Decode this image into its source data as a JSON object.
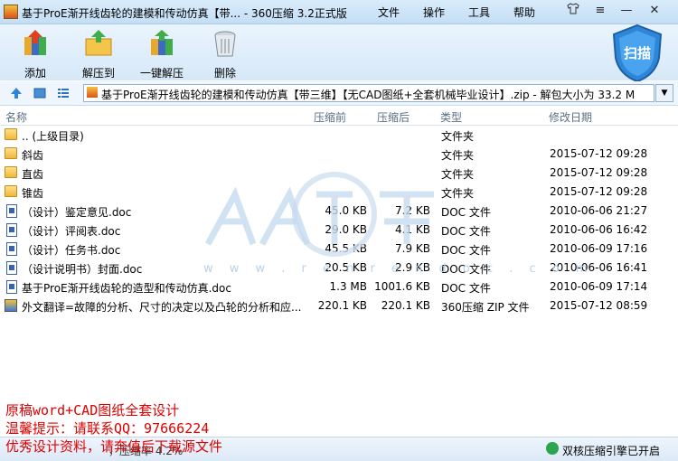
{
  "window": {
    "title": "基于ProE渐开线齿轮的建模和传动仿真【带... - 360压缩 3.2正式版",
    "menu": [
      "文件",
      "操作",
      "工具",
      "帮助"
    ],
    "controls": [
      "shirt-icon",
      "menu-lines-icon",
      "minimize-icon",
      "close-icon"
    ]
  },
  "toolbar": {
    "add": "添加",
    "extract_to": "解压到",
    "one_click_extract": "一键解压",
    "delete": "删除",
    "scan": "扫描"
  },
  "address": {
    "text": "基于ProE渐开线齿轮的建模和传动仿真【带三维】【无CAD图纸+全套机械毕业设计】.zip - 解包大小为 33.2 M"
  },
  "columns": {
    "name": "名称",
    "size": "压缩前",
    "packed": "压缩后",
    "type": "类型",
    "date": "修改日期"
  },
  "files": [
    {
      "icon": "folder-icon",
      "name": ".. (上级目录)",
      "size": "",
      "packed": "",
      "type": "文件夹",
      "date": ""
    },
    {
      "icon": "folder-icon",
      "name": "斜齿",
      "size": "",
      "packed": "",
      "type": "文件夹",
      "date": "2015-07-12 09:28"
    },
    {
      "icon": "folder-icon",
      "name": "直齿",
      "size": "",
      "packed": "",
      "type": "文件夹",
      "date": "2015-07-12 09:28"
    },
    {
      "icon": "folder-icon",
      "name": "锥齿",
      "size": "",
      "packed": "",
      "type": "文件夹",
      "date": "2015-07-12 09:28"
    },
    {
      "icon": "doc-icon",
      "name": "（设计）鉴定意见.doc",
      "size": "45.0 KB",
      "packed": "7.2 KB",
      "type": "DOC 文件",
      "date": "2010-06-06 21:27"
    },
    {
      "icon": "doc-icon",
      "name": "（设计）评阅表.doc",
      "size": "29.0 KB",
      "packed": "4.1 KB",
      "type": "DOC 文件",
      "date": "2010-06-06 16:42"
    },
    {
      "icon": "doc-icon",
      "name": "（设计）任务书.doc",
      "size": "45.5 KB",
      "packed": "7.9 KB",
      "type": "DOC 文件",
      "date": "2010-06-09 17:16"
    },
    {
      "icon": "doc-icon",
      "name": "（设计说明书）封面.doc",
      "size": "20.5 KB",
      "packed": "2.9 KB",
      "type": "DOC 文件",
      "date": "2010-06-06 16:41"
    },
    {
      "icon": "doc-icon",
      "name": "基于ProE渐开线齿轮的造型和传动仿真.doc",
      "size": "1.3 MB",
      "packed": "1001.6 KB",
      "type": "DOC 文件",
      "date": "2010-06-09 17:14"
    },
    {
      "icon": "zip-icon",
      "name": "外文翻译=故障的分析、尺寸的决定以及凸轮的分析和应...",
      "size": "220.1 KB",
      "packed": "220.1 KB",
      "type": "360压缩 ZIP 文件",
      "date": "2015-07-12 08:59"
    }
  ],
  "watermark": {
    "text": "w w w . r e n r e n d o c . c o m"
  },
  "overlay_text": [
    "原稿word+CAD图纸全套设计",
    "温馨提示：请联系QQ：97666224",
    "优秀设计资料，请奔值后下载源文件"
  ],
  "status": {
    "text": "，压缩率 4.2%",
    "right": "双核压缩引擎已开启"
  },
  "colors": {
    "red_text": "#e00000",
    "accent": "#2f86d6"
  }
}
